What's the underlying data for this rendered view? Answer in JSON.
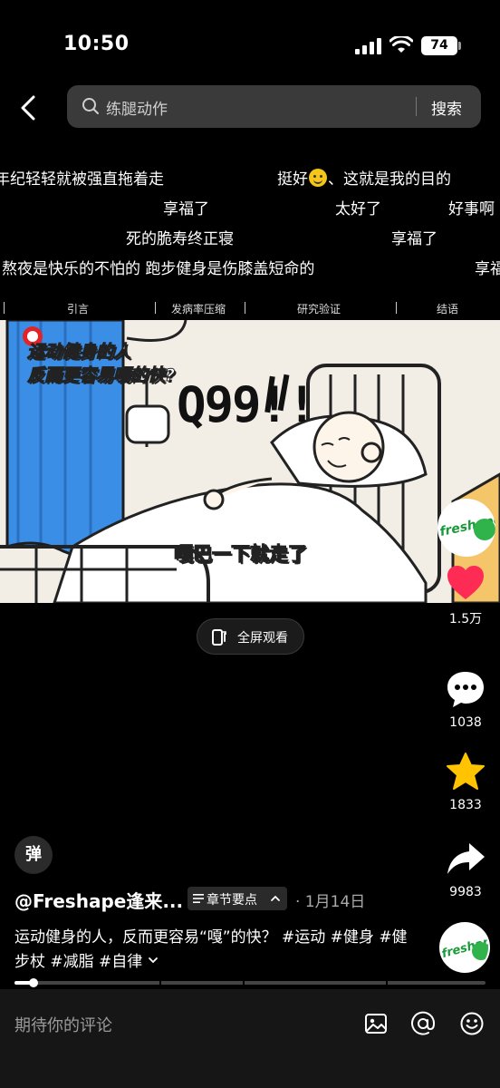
{
  "status_bar": {
    "time": "10:50",
    "battery": "74"
  },
  "search": {
    "query": "练腿动作",
    "button": "搜索"
  },
  "danmaku": [
    {
      "text": "年纪轻轻就被强直拖着走"
    },
    {
      "text_before": "挺好",
      "text_after": "、这就是我的目的"
    },
    {
      "text": "享福了"
    },
    {
      "text": "太好了"
    },
    {
      "text": "好事啊"
    },
    {
      "text": "死的脆寿终正寝"
    },
    {
      "text": "享福了"
    },
    {
      "text": "熬夜是快乐的不怕的 跑步健身是伤膝盖短命的"
    },
    {
      "text": "享福"
    }
  ],
  "chapters": [
    "引言",
    "发病率压缩",
    "研究验证",
    "结语"
  ],
  "video": {
    "title_line1": "运动健身的人",
    "title_line2": "反而更容易嘎的快?",
    "big_text": "Q99!!",
    "subtitle_plain": "嘎巴",
    "subtitle_red": "一下就走",
    "subtitle_end": "了",
    "logo": "freshape"
  },
  "fullscreen": {
    "label": "全屏观看"
  },
  "actions": {
    "likes": "1.5万",
    "comments": "1038",
    "favorites": "1833",
    "shares": "9983",
    "like_color": "#fe2c55",
    "favorite_color": "#ffc300"
  },
  "danmaku_toggle": "弹",
  "author": {
    "name": "@Freshape逢来...",
    "chapter_pill": "章节要点",
    "date": "· 1月14日"
  },
  "description": "运动健身的人，反而更容易“嘎”的快？ #运动 #健身 #健步杖 #减脂 #自律",
  "progress": {
    "played_fraction": 0.04
  },
  "comment": {
    "placeholder": "期待你的评论"
  }
}
